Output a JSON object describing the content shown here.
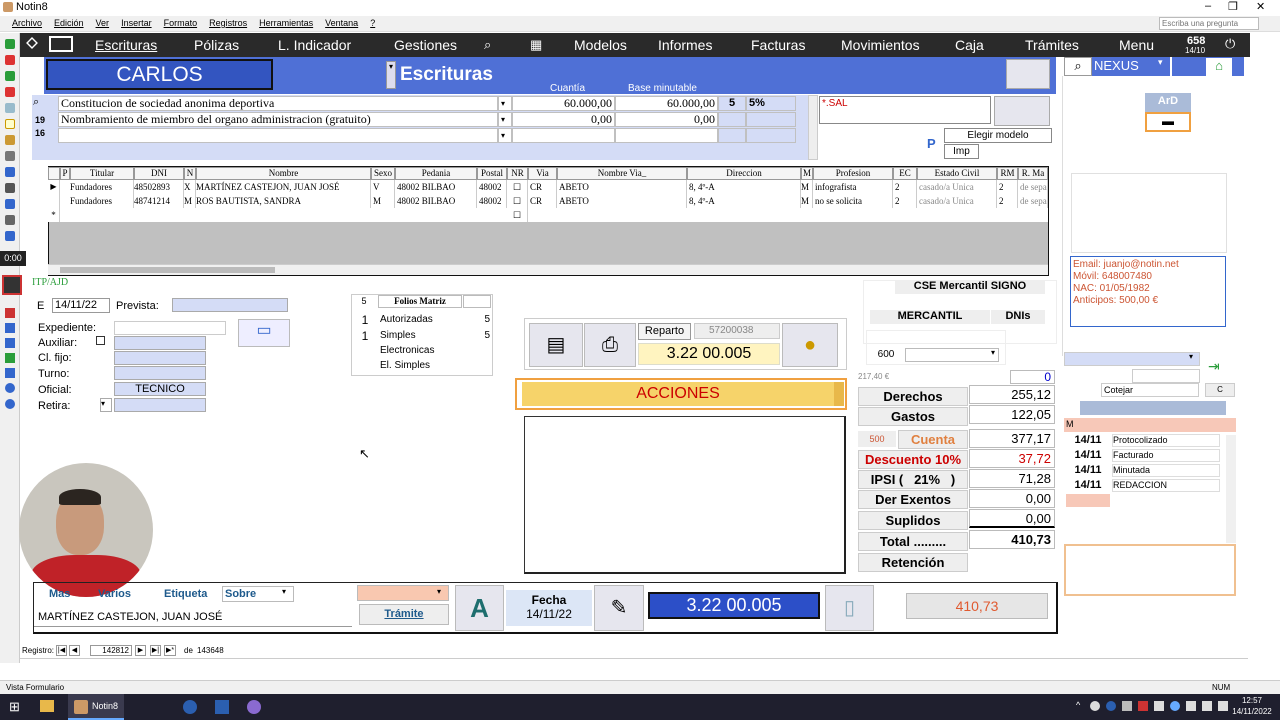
{
  "window": {
    "title": "Notin8",
    "search_placeholder": "Escriba una pregunta"
  },
  "menu": [
    "Archivo",
    "Edición",
    "Ver",
    "Insertar",
    "Formato",
    "Registros",
    "Herramientas",
    "Ventana",
    "?"
  ],
  "nav": {
    "items": [
      "Escrituras",
      "Pólizas",
      "L. Indicador",
      "Gestiones",
      "Modelos",
      "Informes",
      "Facturas",
      "Movimientos",
      "Caja",
      "Trámites",
      "Menu"
    ],
    "counter": "658",
    "counter_date": "14/10"
  },
  "left_timer": "0:00",
  "header": {
    "user": "CARLOS",
    "section": "Escrituras",
    "col_cuantia": "Cuantía",
    "col_base": "Base minutable",
    "nexus": "NEXUS"
  },
  "acts": [
    {
      "num": "",
      "desc": "Constitucion de sociedad anonima deportiva",
      "cuantia": "60.000,00",
      "base": "60.000,00",
      "n": "5",
      "pct": "5%"
    },
    {
      "num": "19",
      "desc": "Nombramiento de miembro del organo administracion (gratuito)",
      "cuantia": "0,00",
      "base": "0,00",
      "n": "",
      "pct": ""
    },
    {
      "num": "16",
      "desc": "",
      "cuantia": "",
      "base": "",
      "n": "",
      "pct": ""
    }
  ],
  "sal_box": "*.SAL",
  "elegir_modelo": "Elegir modelo",
  "imp": "Imp",
  "ard": "ArD",
  "grid": {
    "headers": [
      "P",
      "Titular",
      "DNI",
      "N",
      "Nombre",
      "Sexo",
      "Pedania",
      "Postal",
      "NR",
      "Via",
      "Nombre Via_",
      "Direccion",
      "M",
      "Profesion",
      "EC",
      "Estado Civil",
      "RM",
      "R. Ma"
    ],
    "rows": [
      [
        "Fundadores",
        "48502893",
        "X",
        "MARTÍNEZ CASTEJON, JUAN JOSÉ",
        "V",
        "48002 BILBAO",
        "48002",
        "CR",
        "ABETO",
        "8, 4º-A",
        "M",
        "infografista",
        "2",
        "casado/a  Unica",
        "2",
        "de sepa"
      ],
      [
        "Fundadores",
        "48741214",
        "M",
        "ROS BAUTISTA, SANDRA",
        "M",
        "48002 BILBAO",
        "48002",
        "CR",
        "ABETO",
        "8, 4º-A",
        "M",
        "no se solicita",
        "2",
        "casado/a  Unica",
        "2",
        "de sepa"
      ]
    ]
  },
  "contact": {
    "email": "Email: juanjo@notin.net",
    "movil": "Móvil: 648007480",
    "nac": "NAC: 01/05/1982",
    "anticipos": "Anticipos: 500,00 €"
  },
  "itp": "ITP/AJD",
  "form": {
    "e_label": "E",
    "e_date": "14/11/22",
    "prevista": "Prevista:",
    "expediente": "Expediente:",
    "auxiliar": "Auxiliar:",
    "cl_fijo": "Cl. fijo:",
    "turno": "Turno:",
    "oficial": "Oficial:",
    "oficial_val": "TECNICO",
    "retira": "Retira:"
  },
  "folios": {
    "top_num": "5",
    "title": "Folios Matriz",
    "rows": [
      {
        "n": "1",
        "label": "Autorizadas",
        "v": "5"
      },
      {
        "n": "1",
        "label": "Simples",
        "v": "5"
      },
      {
        "n": "",
        "label": "Electronicas",
        "v": ""
      },
      {
        "n": "",
        "label": "El. Simples",
        "v": ""
      }
    ]
  },
  "reparto": {
    "label": "Reparto",
    "code": "57200038",
    "protocol": "3.22 00.005"
  },
  "acciones": "ACCIONES",
  "cse": "CSE Mercantil SIGNO",
  "mercantil": "MERCANTIL",
  "dnis": "DNIs",
  "code600": "600",
  "small_amount": "217,40 €",
  "zero": "0",
  "totals": [
    {
      "label": "Derechos",
      "value": "255,12"
    },
    {
      "label": "Gastos",
      "value": "122,05"
    },
    {
      "label": "Cuenta",
      "value": "377,17",
      "tag": "500"
    },
    {
      "label": "Descuento 10%",
      "value": "37,72"
    },
    {
      "label": "IPSI (   21%   )",
      "value": "71,28"
    },
    {
      "label": "Der Exentos",
      "value": "0,00"
    },
    {
      "label": "Suplidos",
      "value": "0,00"
    },
    {
      "label": "Total .........",
      "value": "410,73"
    },
    {
      "label": "Retención",
      "value": ""
    }
  ],
  "right_panel": {
    "cotejar": "Cotejar",
    "c": "C",
    "m": "M",
    "status": [
      {
        "date": "14/11",
        "text": "Protocolizado"
      },
      {
        "date": "14/11",
        "text": "Facturado"
      },
      {
        "date": "14/11",
        "text": "Minutada"
      },
      {
        "date": "14/11",
        "text": "REDACCION"
      }
    ]
  },
  "bottom": {
    "tabs": [
      "Mas",
      "Varios",
      "Etiqueta",
      "Sobre"
    ],
    "name": "MARTÍNEZ CASTEJON, JUAN JOSÉ",
    "tramite": "Trámite",
    "fecha_label": "Fecha",
    "fecha": "14/11/22",
    "protocol": "3.22 00.005",
    "total": "410,73",
    "a": "A"
  },
  "record": {
    "label": "Registro:",
    "current": "142812",
    "of": "de",
    "total": "143648"
  },
  "status_bar": {
    "left": "Vista Formulario",
    "right": "NUM"
  },
  "taskbar": {
    "app": "Notin8",
    "time": "12:57",
    "date": "14/11/2022"
  },
  "colors": {
    "nav_bg": "#2a2a2a",
    "blue": "#4f70d6",
    "accent_orange": "#f0a040",
    "red": "#cc0000"
  }
}
